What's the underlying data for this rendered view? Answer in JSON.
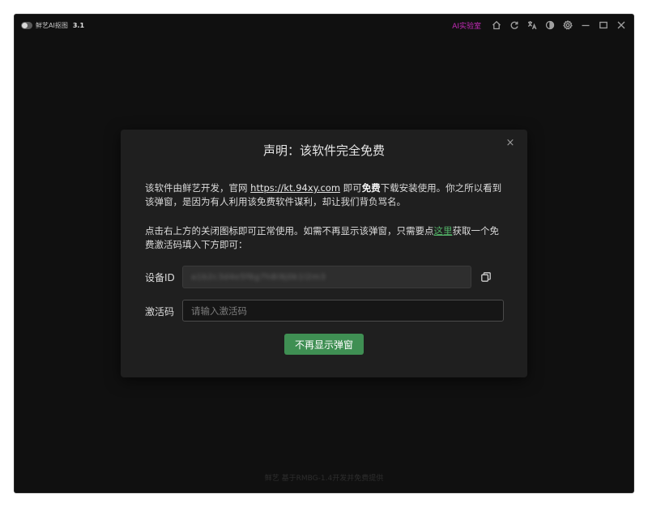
{
  "app": {
    "title": "鲜艺AI抠图",
    "version": "3.1"
  },
  "titlebar": {
    "ai_lab": "AI实验室",
    "icons": [
      "home-icon",
      "refresh-icon",
      "translate-icon",
      "theme-icon",
      "settings-icon",
      "minimize-icon",
      "maximize-icon",
      "close-icon"
    ]
  },
  "dialog": {
    "title": "声明：该软件完全免费",
    "close_glyph": "×",
    "p1_pre": "该软件由鲜艺开发，官网 ",
    "p1_url": "https://kt.94xy.com",
    "p1_mid": " 即可",
    "p1_bold": "免费",
    "p1_post": "下载安装使用。你之所以看到该弹窗，是因为有人利用该免费软件谋利，却让我们背负骂名。",
    "p2_pre": "点击右上方的关闭图标即可正常使用。如需不再显示该弹窗，只需要点",
    "p2_link": "这里",
    "p2_post": "获取一个免费激活码填入下方即可：",
    "device_label": "设备ID",
    "device_value": "a1b2c3d4e5f6g7h8i9j0k1l2m3",
    "code_label": "激活码",
    "code_placeholder": "请输入激活码",
    "code_value": "",
    "confirm_label": "不再显示弹窗"
  },
  "footer": {
    "text": "鲜艺 基于RMBG-1.4开发并免费提供"
  },
  "colors": {
    "accent_green": "#3f8f53",
    "link_green": "#52b167",
    "ai_lab": "#c42bb8",
    "background": "#101010"
  }
}
